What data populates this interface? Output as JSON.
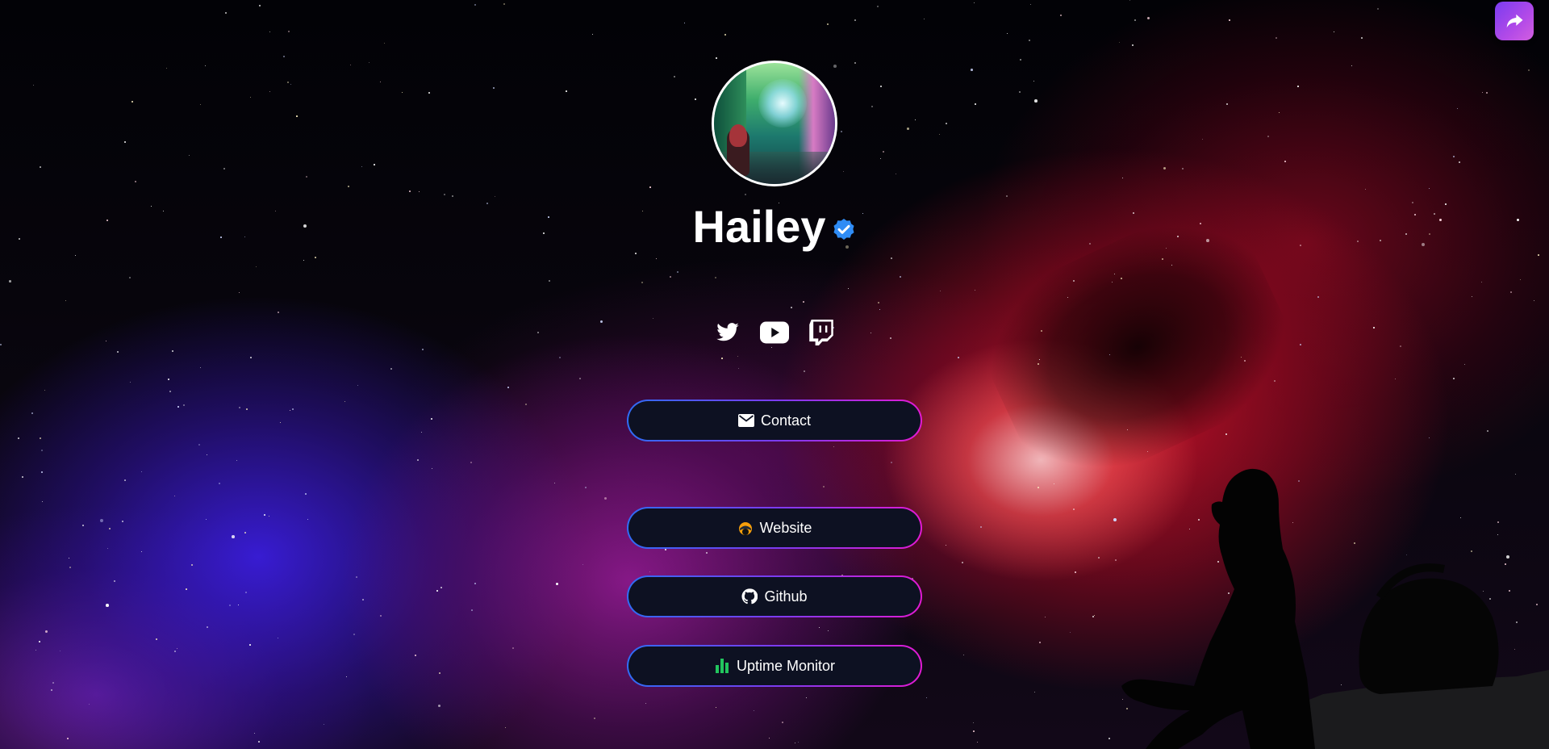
{
  "profile": {
    "name": "Hailey",
    "verified": true
  },
  "socials": [
    {
      "icon": "twitter-icon"
    },
    {
      "icon": "youtube-icon"
    },
    {
      "icon": "twitch-icon"
    }
  ],
  "links": [
    {
      "label": "Contact",
      "icon": "mail-icon"
    },
    {
      "label": "Website",
      "icon": "website-logo-icon"
    },
    {
      "label": "Github",
      "icon": "github-icon"
    },
    {
      "label": "Uptime Monitor",
      "icon": "bar-chart-icon"
    }
  ],
  "share": {
    "icon": "share-icon"
  },
  "colors": {
    "button_bg": "#0d1122",
    "button_border_start": "#2f6cf5",
    "button_border_end": "#e21ad3",
    "share_bg": "#9b44ec",
    "verified": "#2f8cf5",
    "uptime_icon": "#22c55e"
  }
}
